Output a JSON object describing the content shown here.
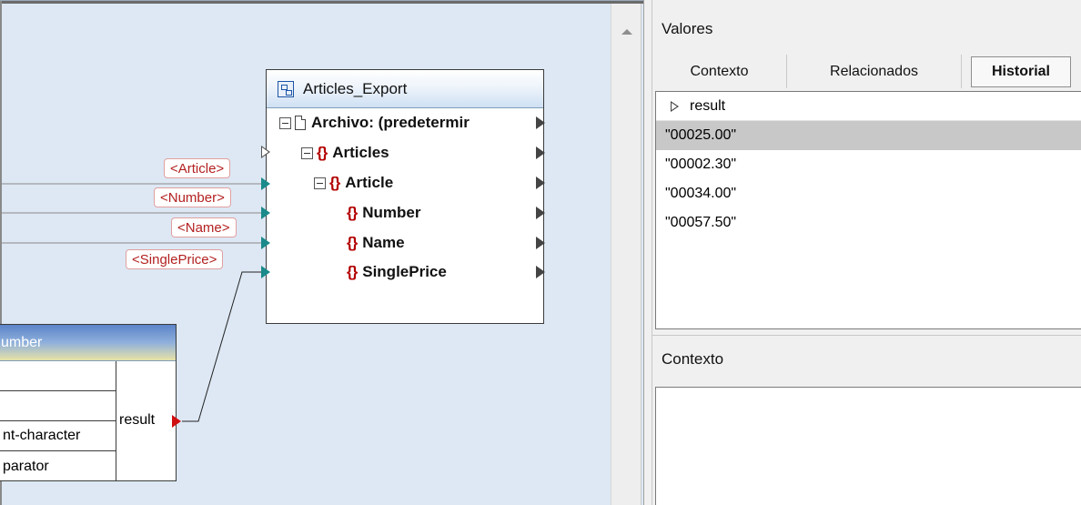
{
  "export_component": {
    "title": "Articles_Export",
    "rows": [
      {
        "label": "Archivo: (predetermir"
      },
      {
        "label": "Articles"
      },
      {
        "label": "Article"
      },
      {
        "label": "Number"
      },
      {
        "label": "Name"
      },
      {
        "label": "SinglePrice"
      }
    ]
  },
  "connection_labels": [
    "<Article>",
    "<Number>",
    "<Name>",
    "<SinglePrice>"
  ],
  "function_component": {
    "title": "umber",
    "params": [
      "",
      "",
      "nt-character",
      "parator"
    ],
    "result_label": "result"
  },
  "values_pane": {
    "title": "Valores",
    "tabs": [
      {
        "label": "Contexto",
        "active": false
      },
      {
        "label": "Relacionados",
        "active": false
      },
      {
        "label": "Historial",
        "active": true
      }
    ],
    "column_header": "result",
    "rows": [
      "\"00025.00\"",
      "\"00002.30\"",
      "\"00034.00\"",
      "\"00057.50\""
    ],
    "selected_row": 0
  },
  "context_pane": {
    "title": "Contexto"
  },
  "colors": {
    "canvas_bg": "#dde8f4",
    "connected_port": "#1a8a8a",
    "result_port": "#d01010",
    "element_braces": "#b30000"
  }
}
